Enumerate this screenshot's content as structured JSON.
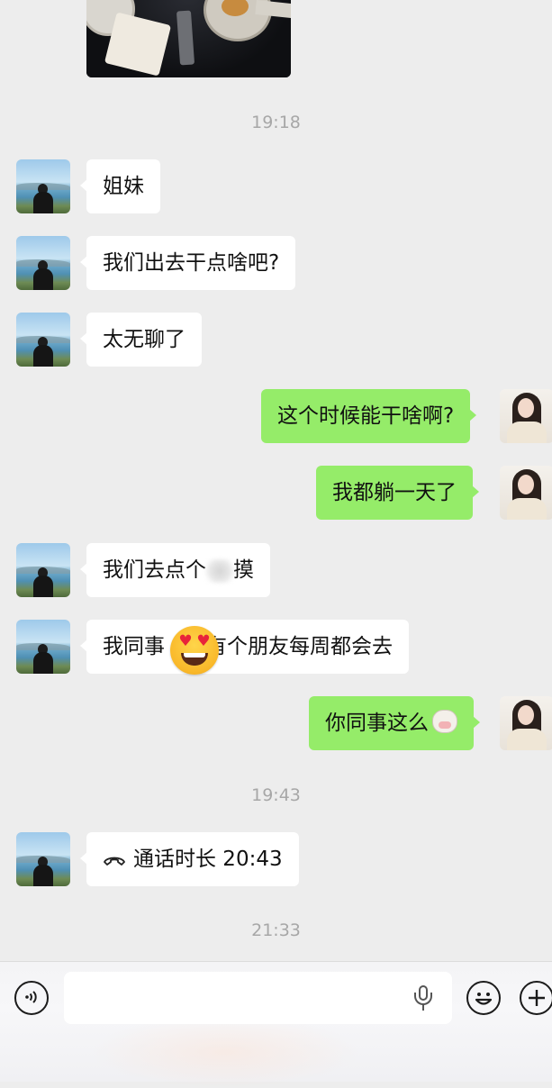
{
  "conversation": {
    "timestamps": [
      "19:18",
      "19:43",
      "21:33"
    ],
    "messages": [
      {
        "side": "in",
        "text": "姐妹"
      },
      {
        "side": "in",
        "text": "我们出去干点啥吧?"
      },
      {
        "side": "in",
        "text": "太无聊了"
      },
      {
        "side": "out",
        "text": "这个时候能干啥啊?"
      },
      {
        "side": "out",
        "text": "我都躺一天了"
      },
      {
        "side": "in",
        "text_before": "我们去点个",
        "text_after": "摸",
        "redacted": true
      },
      {
        "side": "in",
        "text_before": "我同事",
        "text_after": "有个朋友每周都会去",
        "emoji": "heart-eyes-emoji"
      },
      {
        "side": "out",
        "text": "你同事这么",
        "emoji": "cow-emoji"
      }
    ],
    "call": {
      "icon": "phone-hangup-icon",
      "label": "通话时长 20:43"
    }
  },
  "avatars": {
    "contact": "avatar-contact-seaside",
    "self": "avatar-self-girl"
  },
  "input_bar": {
    "voice_icon": "voice-icon",
    "mic_icon": "mic-icon",
    "emoji_icon": "emoji-icon",
    "plus_icon": "plus-icon",
    "input_value": ""
  },
  "colors": {
    "background": "#ededed",
    "bubble_in": "#ffffff",
    "bubble_out": "#95ec69",
    "timestamp": "#a7a7a7"
  }
}
